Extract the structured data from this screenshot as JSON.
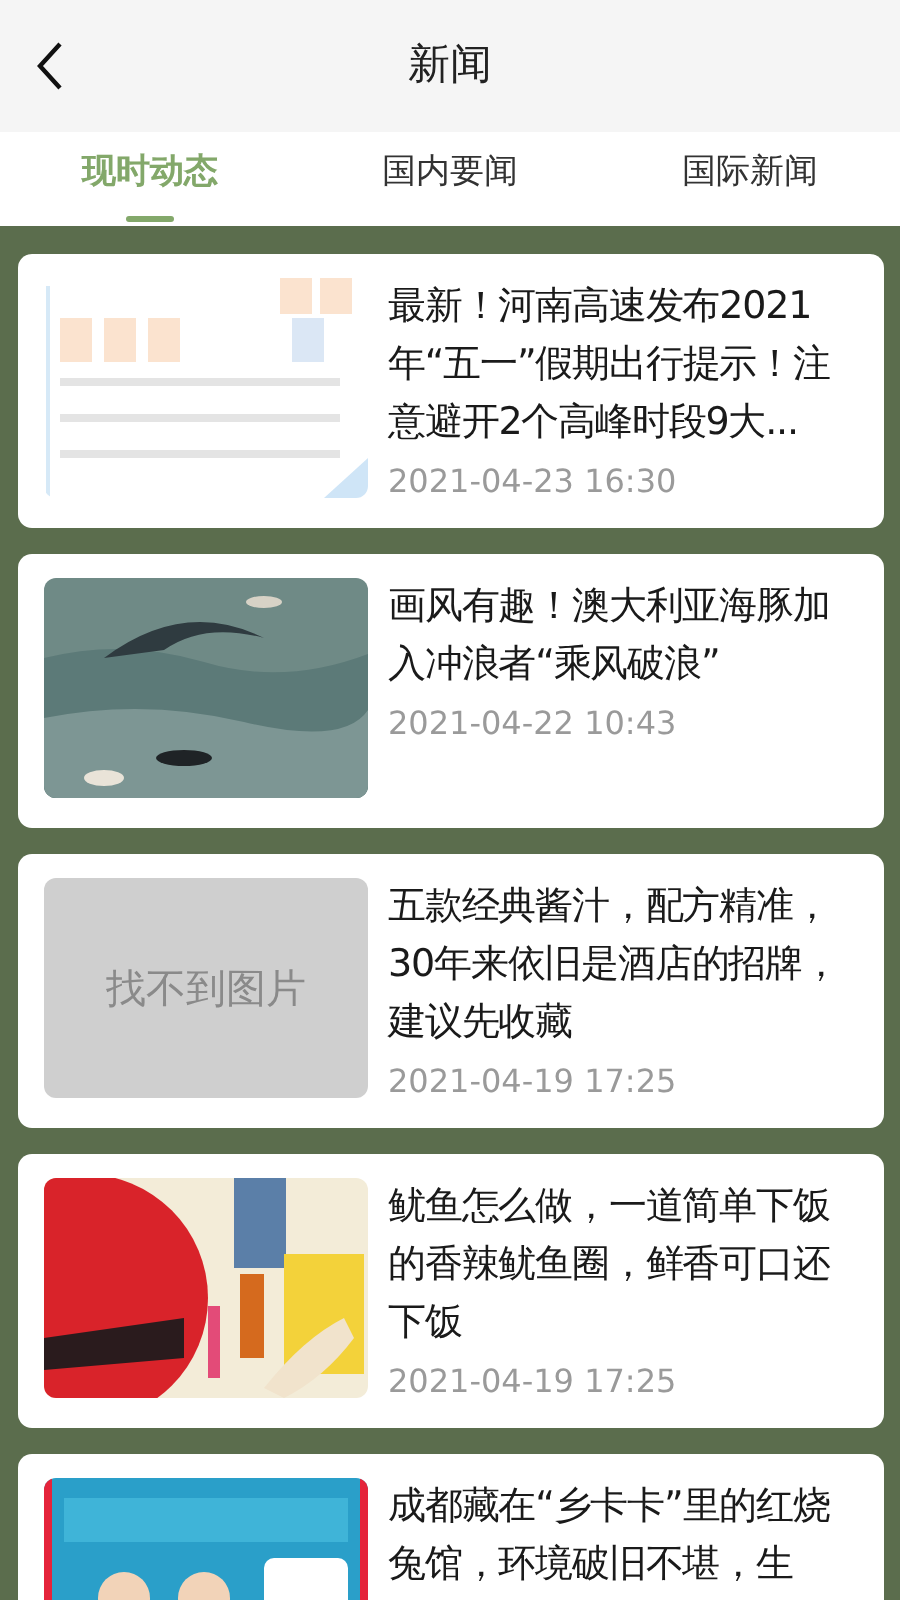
{
  "header": {
    "title": "新闻"
  },
  "tabs": [
    {
      "label": "现时动态",
      "selected": true
    },
    {
      "label": "国内要闻",
      "selected": false
    },
    {
      "label": "国际新闻",
      "selected": false
    }
  ],
  "articles": [
    {
      "title": "最新！河南高速发布2021年“五一”假期出行提示！注意避开2个高峰时段9大...",
      "date": "2021-04-23 16:30"
    },
    {
      "title": "画风有趣！澳大利亚海豚加入冲浪者“乘风破浪”",
      "date": "2021-04-22 10:43"
    },
    {
      "title": "五款经典酱汁，配方精准，30年来依旧是酒店的招牌，建议先收藏",
      "date": "2021-04-19 17:25",
      "thumbnail": {
        "kind": "missing",
        "text": "找不到图片"
      }
    },
    {
      "title": "鱿鱼怎么做，一道简单下饭的香辣鱿鱼圈，鲜香可口还下饭",
      "date": "2021-04-19 17:25"
    },
    {
      "title": "成都藏在“乡卡卡”里的红烧兔馆，环境破旧不堪，生"
    }
  ]
}
